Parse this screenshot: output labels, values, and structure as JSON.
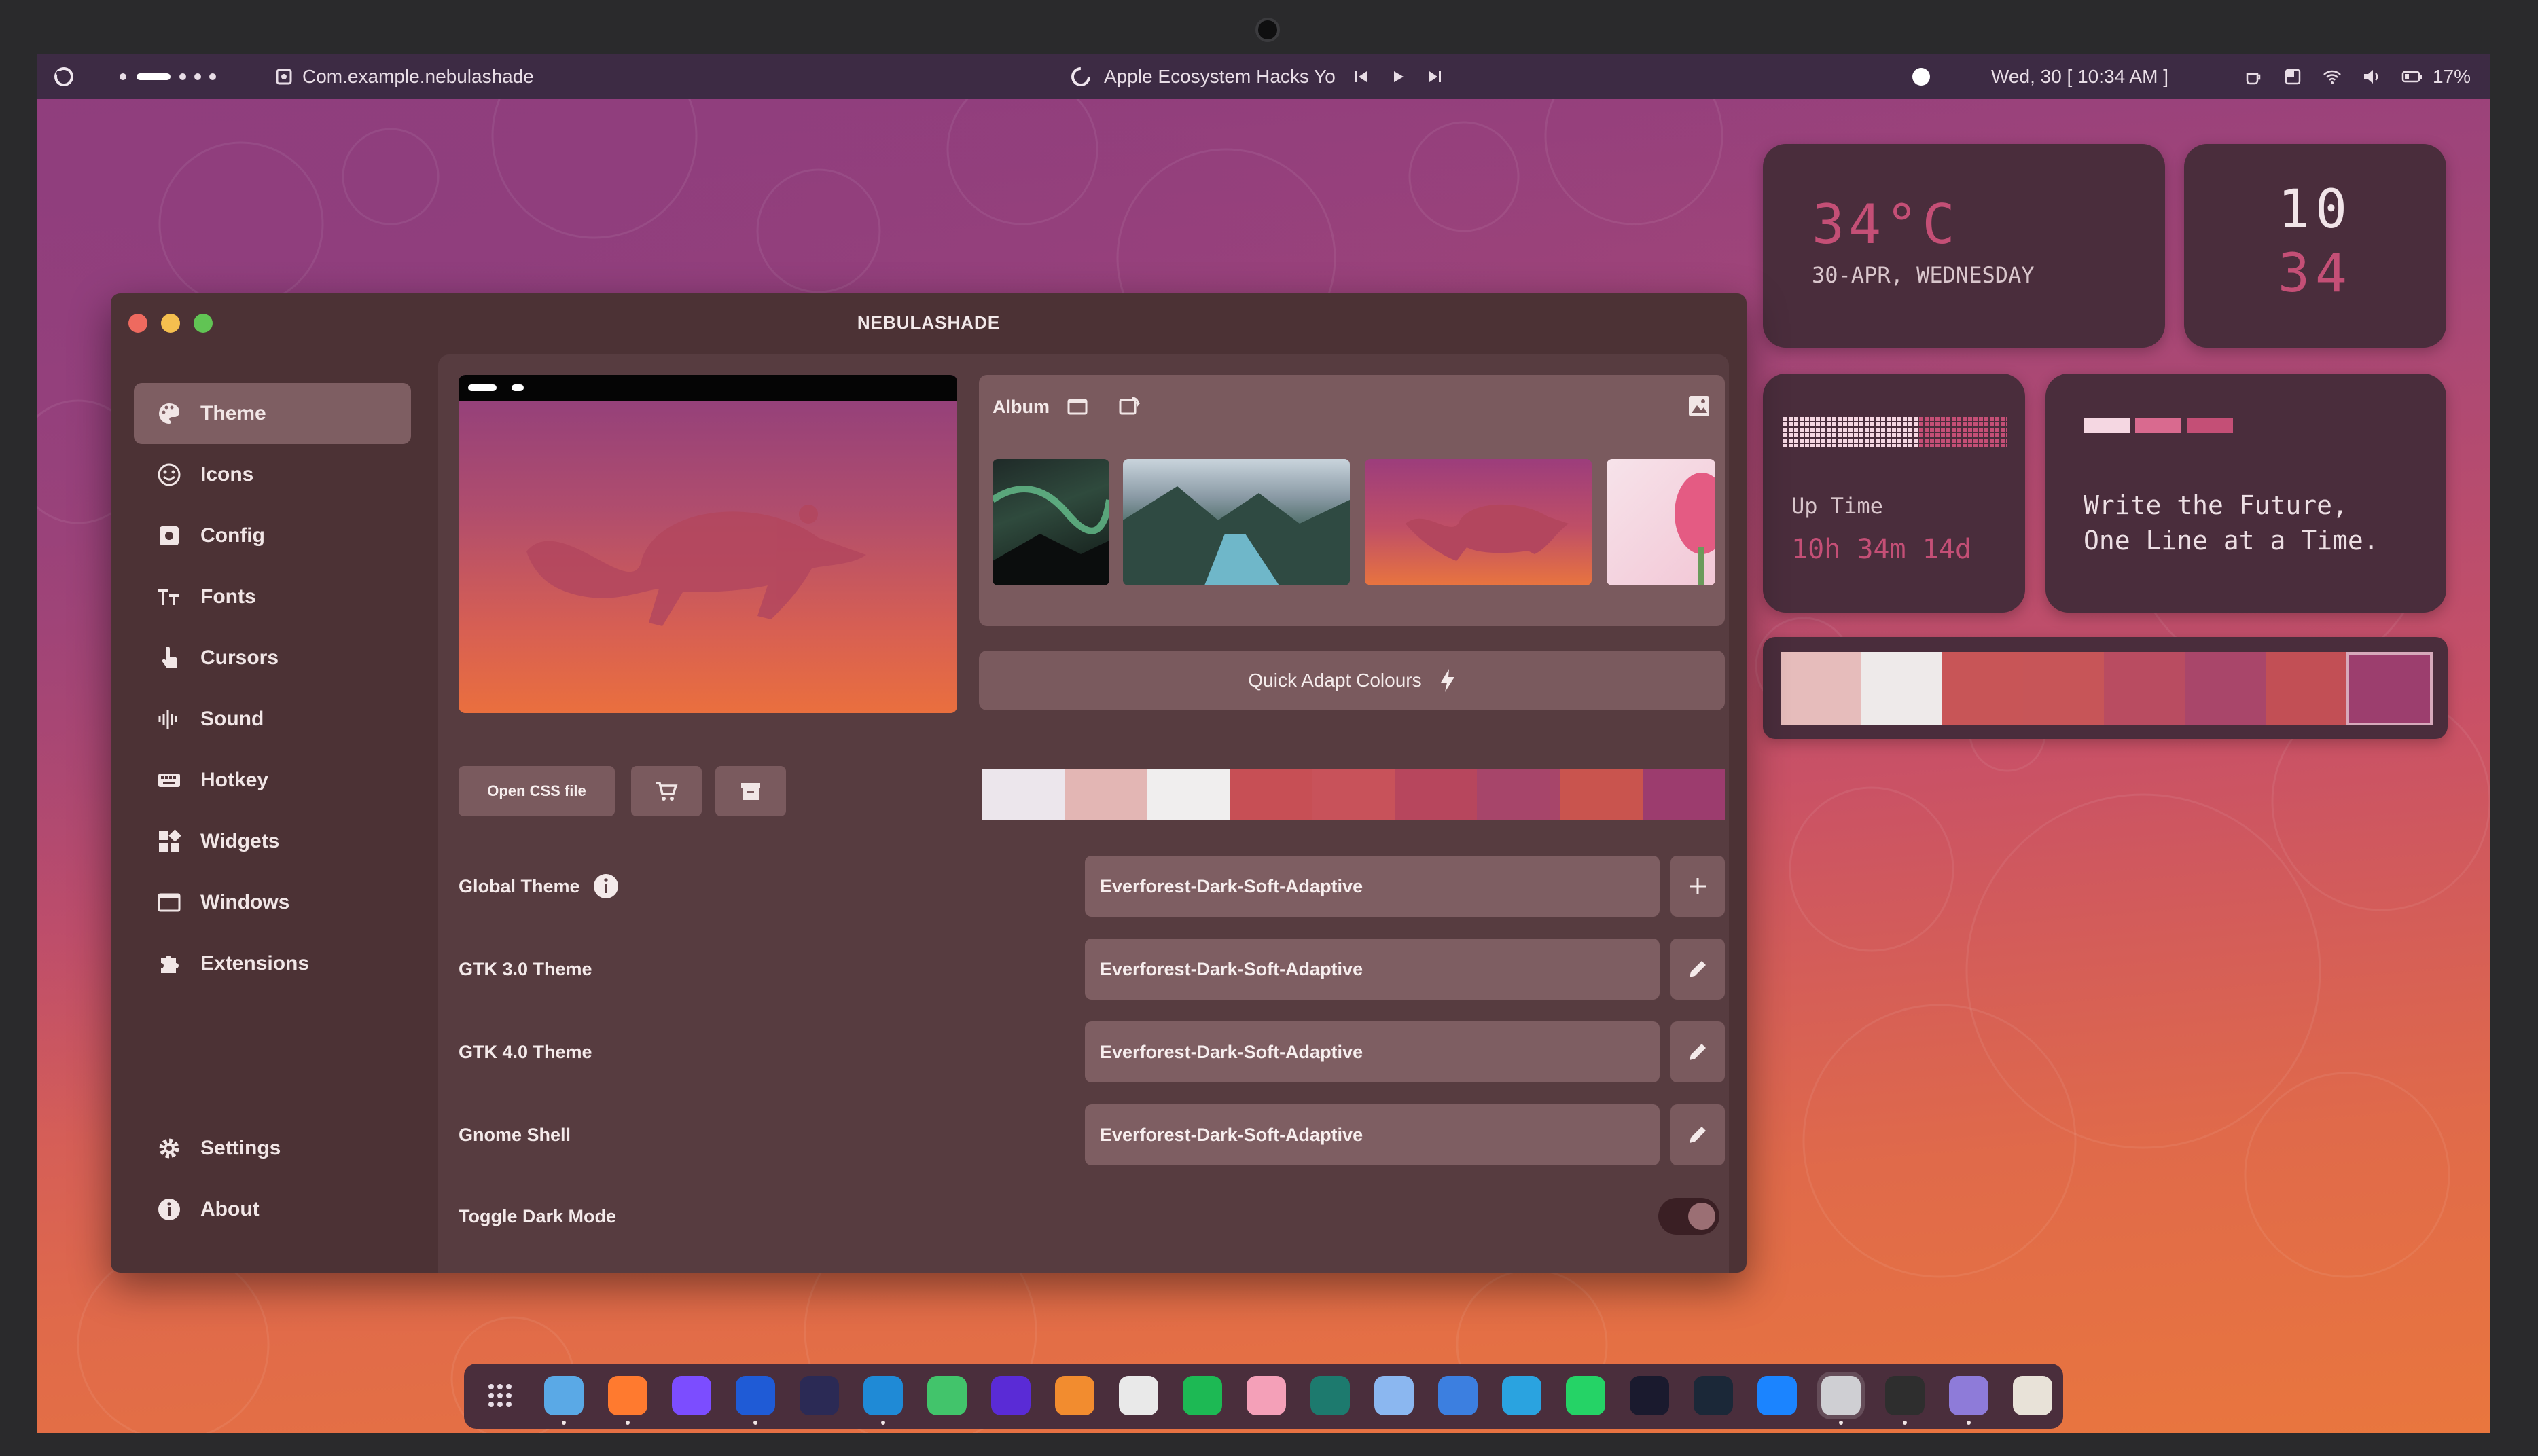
{
  "topbar": {
    "app_name": "Com.example.nebulashade",
    "media_title": "Apple Ecosystem Hacks Yo",
    "datetime": "Wed, 30 [ 10:34 AM ]",
    "battery": "17%"
  },
  "window": {
    "title": "NEBULASHADE",
    "sidebar": [
      {
        "label": "Theme",
        "icon": "palette-icon"
      },
      {
        "label": "Icons",
        "icon": "smiley-icon"
      },
      {
        "label": "Config",
        "icon": "config-icon"
      },
      {
        "label": "Fonts",
        "icon": "text-size-icon"
      },
      {
        "label": "Cursors",
        "icon": "hand-pointer-icon"
      },
      {
        "label": "Sound",
        "icon": "waveform-icon"
      },
      {
        "label": "Hotkey",
        "icon": "keyboard-icon"
      },
      {
        "label": "Widgets",
        "icon": "widgets-icon"
      },
      {
        "label": "Windows",
        "icon": "window-icon"
      },
      {
        "label": "Extensions",
        "icon": "puzzle-icon"
      }
    ],
    "sidebar_bottom": [
      {
        "label": "Settings",
        "icon": "gear-icon"
      },
      {
        "label": "About",
        "icon": "info-icon"
      }
    ],
    "album_label": "Album",
    "quick_adapt_label": "Quick Adapt Colours",
    "open_css_label": "Open CSS file",
    "palette": [
      "#ece6ec",
      "#e3b6b4",
      "#f0eeee",
      "#c74f55",
      "#c8525a",
      "#b7465d",
      "#a7456a",
      "#c9544e",
      "#9c3c6e"
    ],
    "theme_rows": [
      {
        "label": "Global Theme",
        "value": "Everforest-Dark-Soft-Adaptive",
        "action": "plus-icon"
      },
      {
        "label": "GTK 3.0 Theme",
        "value": "Everforest-Dark-Soft-Adaptive",
        "action": "pencil-icon"
      },
      {
        "label": "GTK 4.0 Theme",
        "value": "Everforest-Dark-Soft-Adaptive",
        "action": "pencil-icon"
      },
      {
        "label": "Gnome Shell",
        "value": "Everforest-Dark-Soft-Adaptive",
        "action": "pencil-icon"
      }
    ],
    "dark_mode_label": "Toggle Dark Mode",
    "dark_mode_on": true
  },
  "widgets": {
    "weather_temp": "34°C",
    "weather_date": "30-APR, WEDNESDAY",
    "clock_hour": "10",
    "clock_minute": "34",
    "uptime_label": "Up Time",
    "uptime_value": "10h 34m 14d",
    "quote_line1": "Write the Future,",
    "quote_line2": "One Line at a Time.",
    "palette": [
      "#e6bcbb",
      "#eeeaea",
      "#c85557",
      "#c75558",
      "#b94c61",
      "#a9466a",
      "#c24f55",
      "#9c3e6e"
    ]
  },
  "dock": {
    "apps": [
      "apps-grid-icon",
      "files-icon",
      "firefox-icon",
      "obsidian-icon",
      "word-icon",
      "terminal-icon",
      "vscode-icon",
      "leaf-icon",
      "browser-icon",
      "gimp-icon",
      "inkscape-icon",
      "spotify-icon",
      "photos-icon",
      "globe-icon",
      "tools-icon",
      "builder-icon",
      "telegram-icon",
      "whatsapp-icon",
      "headphones-icon",
      "steam-icon",
      "appstore-icon",
      "settings-icon",
      "console-icon",
      "image-viewer-icon",
      "trash-icon"
    ]
  }
}
